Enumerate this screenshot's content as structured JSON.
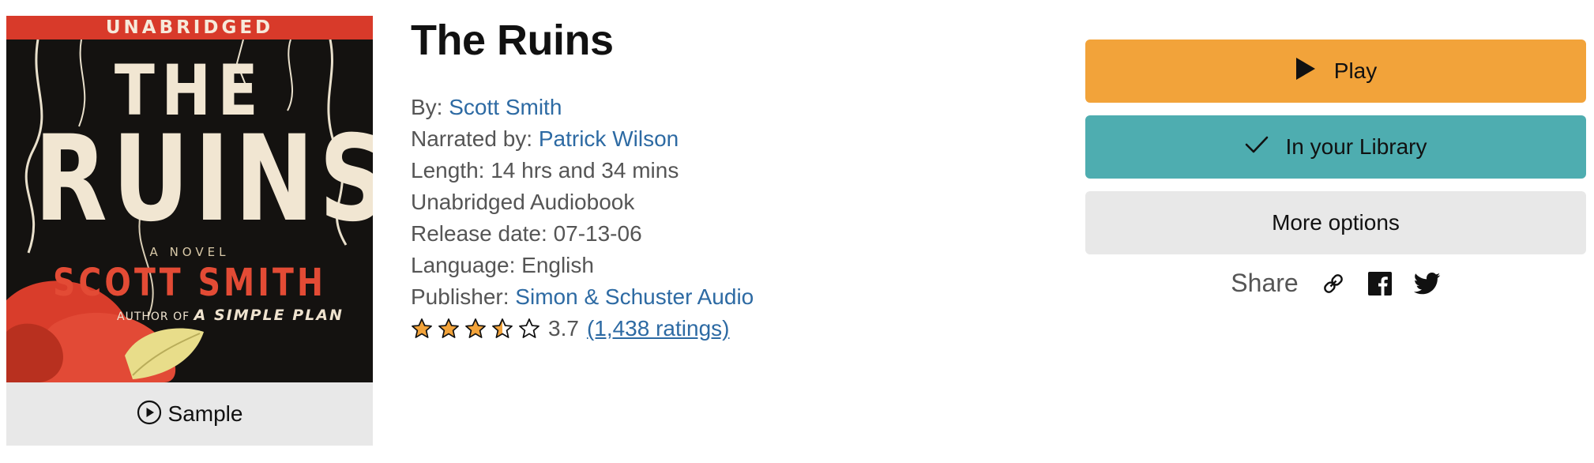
{
  "cover": {
    "banner": "UNABRIDGED",
    "title_line1": "THE",
    "title_line2": "RUINS",
    "subtitle": "A NOVEL",
    "author": "SCOTT SMITH",
    "author_of_prefix": "AUTHOR OF",
    "author_of_title": "A SIMPLE PLAN"
  },
  "sample": {
    "label": "Sample",
    "icon": "play-circle-icon"
  },
  "book": {
    "title": "The Ruins",
    "by_label": "By:",
    "author": "Scott Smith",
    "narrated_label": "Narrated by:",
    "narrator": "Patrick Wilson",
    "length": "Length: 14 hrs and 34 mins",
    "format": "Unabridged Audiobook",
    "release": "Release date: 07-13-06",
    "language": "Language: English",
    "publisher_label": "Publisher:",
    "publisher": "Simon & Schuster Audio",
    "rating": {
      "value": 3.7,
      "value_text": "3.7",
      "count_text": "(1,438 ratings)",
      "max": 5
    }
  },
  "actions": {
    "play": {
      "label": "Play",
      "icon": "play-icon",
      "color": "#f2a33a"
    },
    "library": {
      "label": "In your Library",
      "icon": "checkmark-icon",
      "color": "#4eadb0"
    },
    "more": {
      "label": "More options",
      "color": "#e8e8e8"
    }
  },
  "share": {
    "label": "Share",
    "icons": [
      "link-icon",
      "facebook-icon",
      "twitter-icon"
    ]
  },
  "colors": {
    "link": "#2d6aa3",
    "star": "#f2a33a"
  }
}
